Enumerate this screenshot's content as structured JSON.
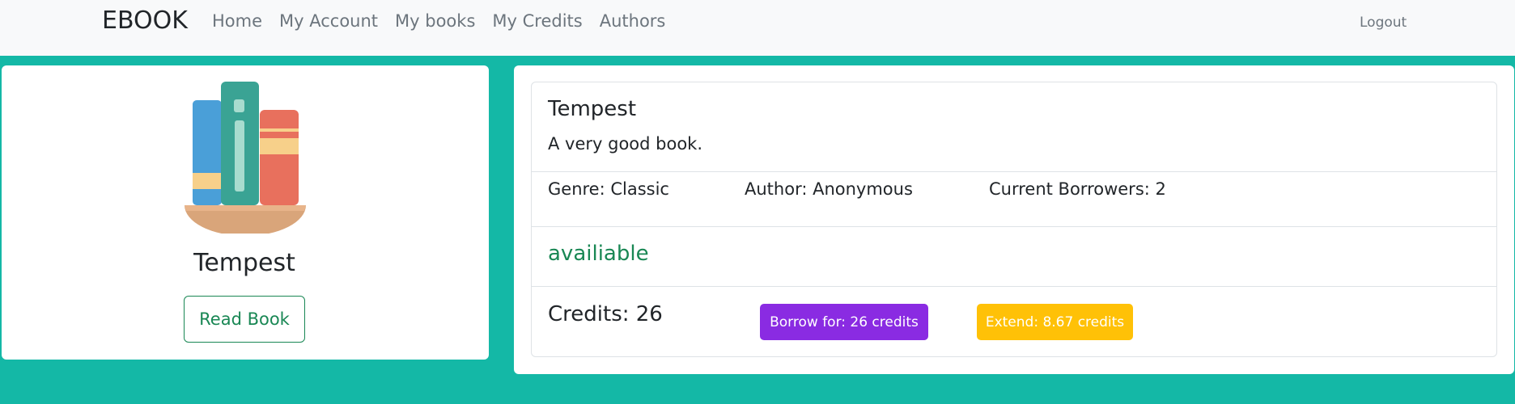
{
  "navbar": {
    "brand": "EBOOK",
    "links": [
      "Home",
      "My Account",
      "My books",
      "My Credits",
      "Authors"
    ],
    "logout": "Logout"
  },
  "left_card": {
    "icon": "books-on-shelf-icon",
    "title": "Tempest",
    "read_button": "Read Book"
  },
  "book": {
    "title": "Tempest",
    "description": "A very good book.",
    "genre": "Genre: Classic",
    "author": "Author: Anonymous",
    "borrowers": "Current Borrowers: 2",
    "status": "availiable",
    "credits": "Credits: 26",
    "borrow_button": "Borrow for: 26 credits",
    "extend_button": "Extend: 8.67 credits"
  },
  "colors": {
    "background": "#14b8a6",
    "borrow": "#8a2be2",
    "extend": "#ffc107",
    "status": "#198754"
  }
}
